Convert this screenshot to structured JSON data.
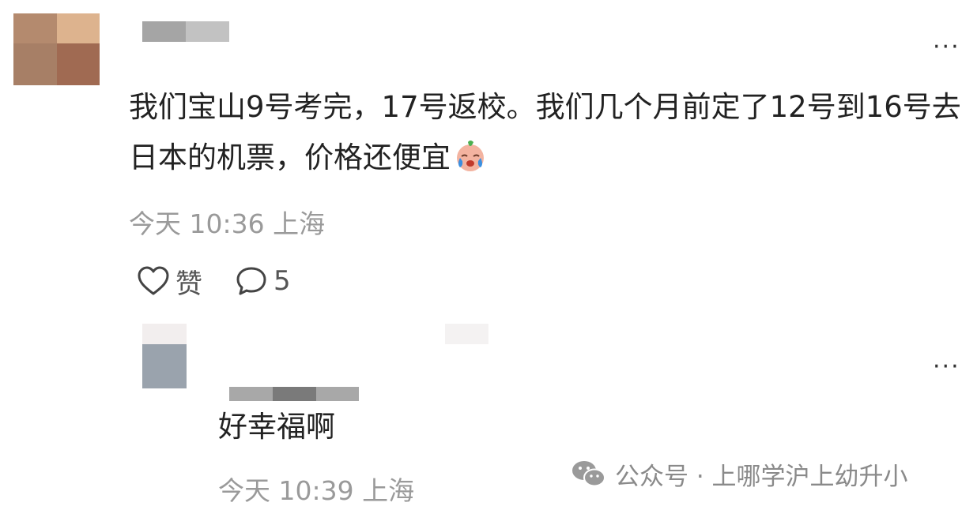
{
  "comment": {
    "text": "我们宝山9号考完，17号返校。我们几个月前定了12号到16号去日本的机票，价格还便宜",
    "time": "今天 10:36",
    "location": "上海",
    "like_label": "赞",
    "reply_count": "5",
    "more_label": "···"
  },
  "reply": {
    "text": "好幸福啊",
    "time": "今天 10:39",
    "location": "上海",
    "more_label": "···"
  },
  "watermark": {
    "text": "公众号 · 上哪学沪上幼升小"
  },
  "colors": {
    "meta_text": "#9a9a9a",
    "body_text": "#222222",
    "avatar_main": [
      "#b48a6e",
      "#ddb38e",
      "#a77f66",
      "#a06a52"
    ],
    "avatar_reply": [
      "#f2eeee",
      "#9aa3ad"
    ]
  },
  "icons": [
    "heart-outline-icon",
    "comment-bubble-icon",
    "more-dots-icon",
    "crying-emoji-icon",
    "wechat-icon"
  ]
}
